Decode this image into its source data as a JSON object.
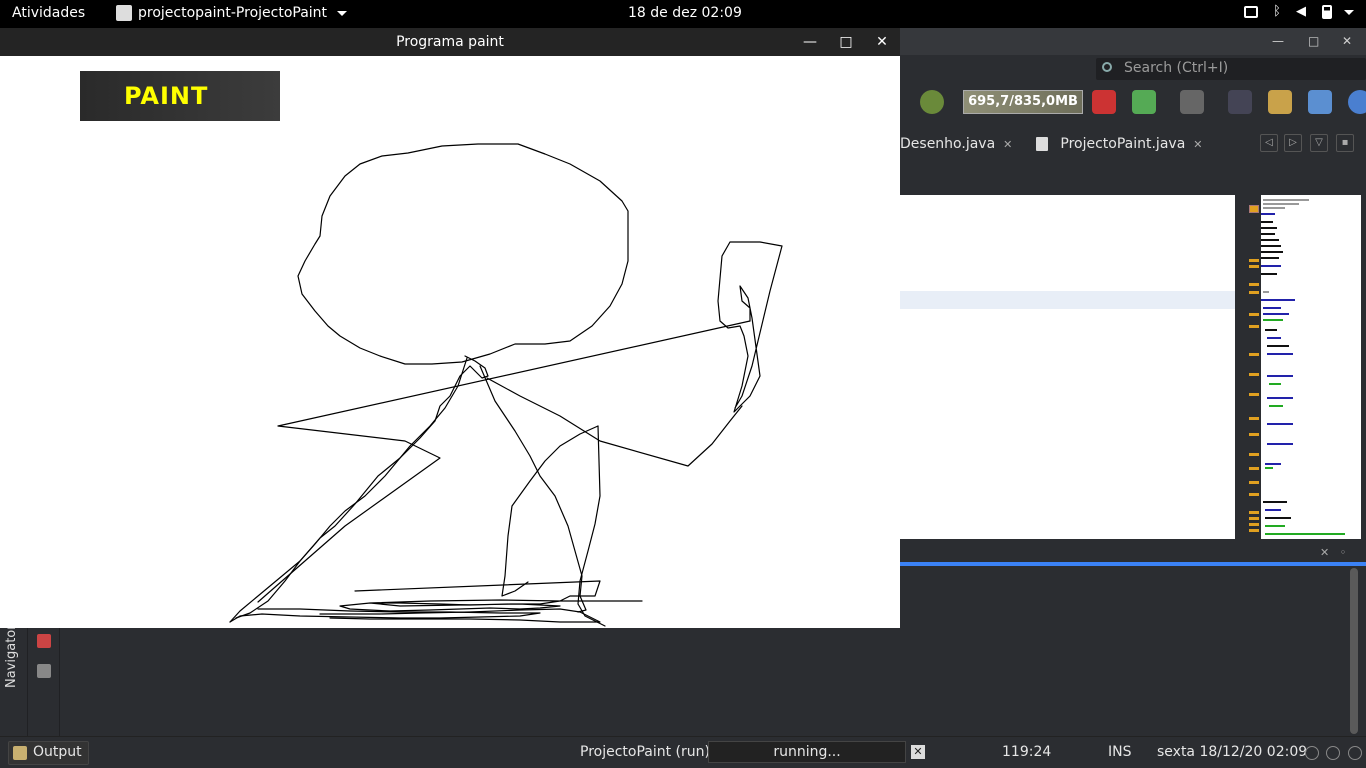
{
  "topbar": {
    "activities": "Atividades",
    "app_name": "projectopaint-ProjectoPaint",
    "clock": "18 de dez  02:09"
  },
  "ide": {
    "search_placeholder": "Search (Ctrl+I)",
    "memory": "695,7/835,0MB",
    "tabs": [
      {
        "label": "Desenho.java"
      },
      {
        "label": "ProjectoPaint.java"
      }
    ],
    "side_label": "Navigator"
  },
  "paint": {
    "window_title": "Programa paint",
    "logo_text": "PAINT"
  },
  "status": {
    "output_label": "Output",
    "process": "ProjectoPaint (run)",
    "progress_text": "running...",
    "cursor_pos": "119:24",
    "mode": "INS",
    "datetime": "sexta 18/12/20 02:09"
  },
  "colors": {
    "logo_text": "#ffff00",
    "progress_accent": "#3b82f6"
  }
}
